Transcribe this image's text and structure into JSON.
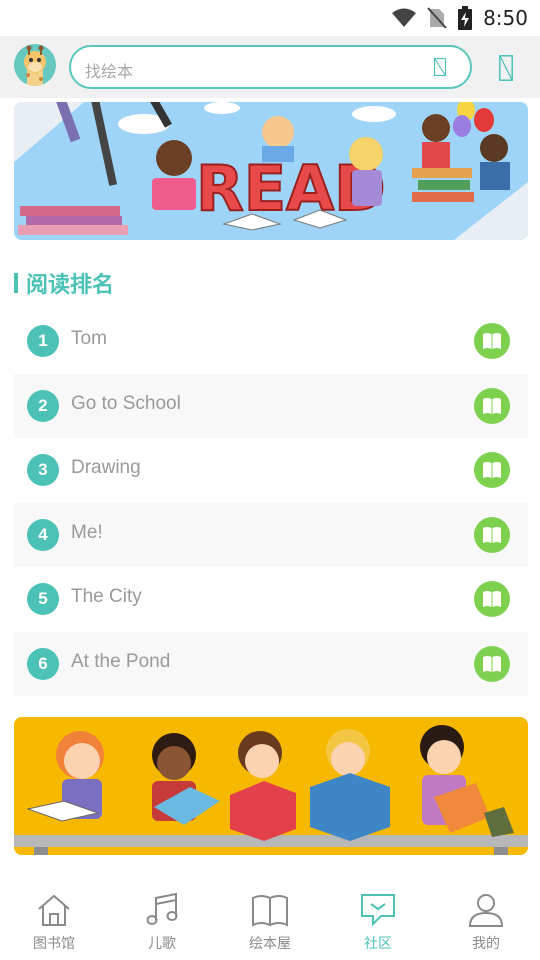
{
  "status_bar": {
    "time": "8:50",
    "icons": [
      "wifi-icon",
      "no-sim-icon",
      "battery-charging-icon"
    ]
  },
  "header": {
    "avatar_icon": "giraffe-avatar",
    "search_placeholder": "找绘本",
    "search_icon": "search-icon",
    "scan_icon": "scan-icon"
  },
  "banner_top": {
    "text": "READ"
  },
  "ranking": {
    "title": "阅读排名",
    "items": [
      {
        "rank": "1",
        "title": "Tom"
      },
      {
        "rank": "2",
        "title": "Go to School"
      },
      {
        "rank": "3",
        "title": "Drawing"
      },
      {
        "rank": "4",
        "title": "Me!"
      },
      {
        "rank": "5",
        "title": "The City"
      },
      {
        "rank": "6",
        "title": "At the Pond"
      }
    ]
  },
  "bottom_nav": {
    "items": [
      {
        "label": "图书馆",
        "icon": "house-icon"
      },
      {
        "label": "儿歌",
        "icon": "music-note-icon"
      },
      {
        "label": "绘本屋",
        "icon": "open-book-icon"
      },
      {
        "label": "社区",
        "icon": "chat-bubble-icon",
        "active": true
      },
      {
        "label": "我的",
        "icon": "person-icon"
      }
    ]
  },
  "colors": {
    "accent": "#4cc2b7",
    "read_button": "#7ed14e",
    "banner_top_bg": "#9ed4f7",
    "banner_bottom_bg": "#f7b900"
  }
}
